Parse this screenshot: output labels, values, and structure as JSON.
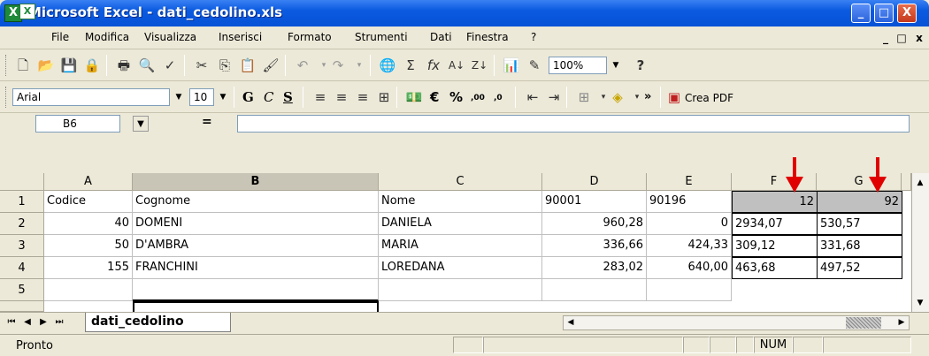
{
  "window": {
    "title": "Microsoft Excel - dati_cedolino.xls",
    "minimize": "_",
    "maximize": "□",
    "close": "X"
  },
  "menu": {
    "items": [
      "File",
      "Modifica",
      "Visualizza",
      "Inserisci",
      "Formato",
      "Strumenti",
      "Dati",
      "Finestra",
      "?"
    ],
    "mdi_min": "_",
    "mdi_restore": "□",
    "mdi_close": "x"
  },
  "toolbar_standard": {
    "zoom": "100%",
    "help_icon": "?"
  },
  "toolbar_format": {
    "font": "Arial",
    "size": "10",
    "bold": "G",
    "italic": "C",
    "underline": "S",
    "euro": "€",
    "percent": "%",
    "inc_dec": ",00",
    "dec_dec": ",0",
    "crea_pdf": "Crea PDF",
    "more": "»"
  },
  "formula_bar": {
    "name_box": "B6",
    "equals": "="
  },
  "grid": {
    "columns": [
      "A",
      "B",
      "C",
      "D",
      "E",
      "F",
      "G"
    ],
    "rows": [
      "1",
      "2",
      "3",
      "4",
      "5"
    ],
    "cells": {
      "A1": "Codice",
      "B1": "Cognome",
      "C1": "Nome",
      "D1": "90001",
      "E1": "90196",
      "F1": "12",
      "G1": "92",
      "A2": "40",
      "B2": "DOMENI",
      "C2": "DANIELA",
      "D2": "960,28",
      "E2": "0",
      "F2": "2934,07",
      "G2": "530,57",
      "A3": "50",
      "B3": "D'AMBRA",
      "C3": "MARIA",
      "D3": "336,66",
      "E3": "424,33",
      "F3": "309,12",
      "G3": "331,68",
      "A4": "155",
      "B4": "FRANCHINI",
      "C4": "LOREDANA",
      "D4": "283,02",
      "E4": "640,00",
      "F4": "463,68",
      "G4": "497,52"
    }
  },
  "sheet_tabs": {
    "active": "dati_cedolino"
  },
  "status": {
    "text": "Pronto",
    "num": "NUM"
  },
  "colors": {
    "arrow": "#e00000",
    "titlebar": "#0a5ae0"
  }
}
